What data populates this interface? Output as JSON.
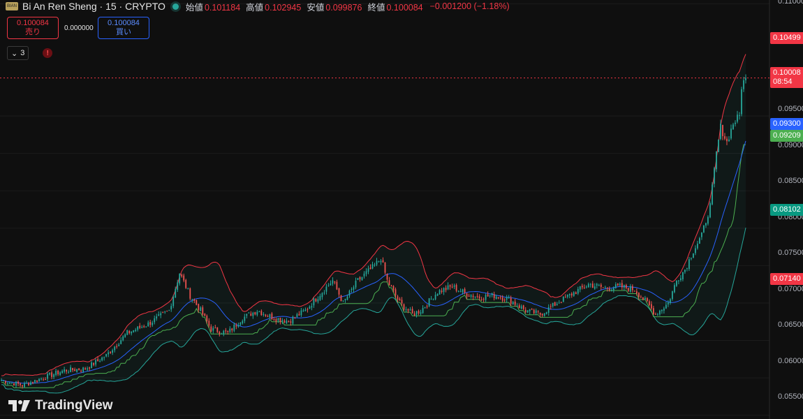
{
  "header": {
    "logo_text": "BIAN",
    "title": "Bi An Ren Sheng · 15 · CRYPTO",
    "ohlc": [
      {
        "label": "始値",
        "value": "0.101184"
      },
      {
        "label": "高値",
        "value": "0.102945"
      },
      {
        "label": "安値",
        "value": "0.099876"
      },
      {
        "label": "終値",
        "value": "0.100084"
      }
    ],
    "change": "−0.001200 (−1.18%)"
  },
  "trade": {
    "sell_price": "0.100084",
    "sell_label": "売り",
    "spread": "0.000000",
    "buy_price": "0.100084",
    "buy_label": "買い"
  },
  "indicators": {
    "count": "3"
  },
  "price_scale": {
    "ticks": [
      "0.11000",
      "0.09500",
      "0.09000",
      "0.08500",
      "0.08000",
      "0.07500",
      "0.07000",
      "0.06500",
      "0.06000",
      "0.05500"
    ],
    "current_price": "0.10008",
    "countdown": "08:54",
    "badges": [
      {
        "name": "upper-band-badge",
        "text": "0.10499",
        "color": "#f23645"
      },
      {
        "name": "ma-badge",
        "text": "0.09300",
        "color": "#2962ff"
      },
      {
        "name": "lower-cloud-badge",
        "text": "0.09209",
        "color": "#4caf50"
      },
      {
        "name": "lower-band-badge",
        "text": "0.08102",
        "color": "#089981"
      },
      {
        "name": "support-badge",
        "text": "0.07140",
        "color": "#f23645"
      }
    ]
  },
  "colors": {
    "up": "#26a69a",
    "down": "#ef5350",
    "upper_band": "#f23645",
    "lower_band": "#26a69a",
    "basis": "#2962ff",
    "baseline": "#4caf50"
  },
  "watermark": {
    "text": "TradingView",
    "icon": "tradingview-logo-icon"
  },
  "chart_data": {
    "type": "candlestick",
    "ylim": [
      0.0545,
      0.1105
    ],
    "ticks": [
      0.11,
      0.095,
      0.09,
      0.085,
      0.08,
      0.075,
      0.07,
      0.065,
      0.06,
      0.055
    ],
    "current_price": 0.100084,
    "close_anchors": [
      [
        0,
        0.0597
      ],
      [
        10,
        0.059
      ],
      [
        20,
        0.06
      ],
      [
        30,
        0.061
      ],
      [
        40,
        0.0612
      ],
      [
        50,
        0.063
      ],
      [
        55,
        0.0645
      ],
      [
        60,
        0.066
      ],
      [
        70,
        0.0672
      ],
      [
        80,
        0.069
      ],
      [
        85,
        0.074
      ],
      [
        90,
        0.071
      ],
      [
        95,
        0.069
      ],
      [
        100,
        0.0665
      ],
      [
        108,
        0.066
      ],
      [
        115,
        0.068
      ],
      [
        122,
        0.069
      ],
      [
        130,
        0.068
      ],
      [
        137,
        0.0676
      ],
      [
        145,
        0.069
      ],
      [
        152,
        0.0712
      ],
      [
        158,
        0.073
      ],
      [
        163,
        0.07
      ],
      [
        170,
        0.073
      ],
      [
        178,
        0.075
      ],
      [
        181,
        0.076
      ],
      [
        184,
        0.073
      ],
      [
        190,
        0.07
      ],
      [
        196,
        0.0685
      ],
      [
        200,
        0.069
      ],
      [
        208,
        0.0715
      ],
      [
        215,
        0.0722
      ],
      [
        222,
        0.0712
      ],
      [
        228,
        0.0708
      ],
      [
        235,
        0.071
      ],
      [
        242,
        0.0705
      ],
      [
        250,
        0.069
      ],
      [
        257,
        0.0685
      ],
      [
        265,
        0.07
      ],
      [
        272,
        0.0712
      ],
      [
        280,
        0.0725
      ],
      [
        288,
        0.072
      ],
      [
        295,
        0.0722
      ],
      [
        302,
        0.0718
      ],
      [
        308,
        0.07
      ],
      [
        312,
        0.0685
      ],
      [
        318,
        0.07
      ],
      [
        322,
        0.073
      ],
      [
        326,
        0.0745
      ],
      [
        330,
        0.077
      ],
      [
        334,
        0.079
      ],
      [
        338,
        0.083
      ],
      [
        341,
        0.09
      ],
      [
        343,
        0.0935
      ],
      [
        346,
        0.0915
      ],
      [
        349,
        0.094
      ],
      [
        352,
        0.095
      ],
      [
        353,
        0.099
      ],
      [
        355,
        0.1001
      ]
    ],
    "bands_note": "",
    "bars": 356
  }
}
